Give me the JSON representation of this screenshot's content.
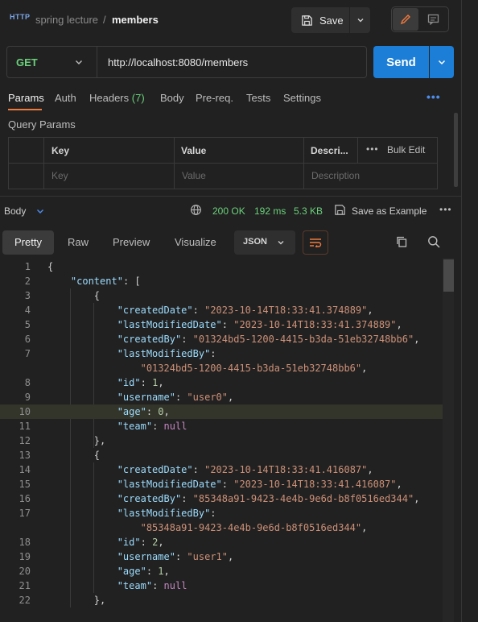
{
  "header": {
    "http_badge": "HTTP",
    "breadcrumb_parent": "spring lecture",
    "breadcrumb_separator": "/",
    "breadcrumb_current": "members",
    "save_label": "Save"
  },
  "request": {
    "method": "GET",
    "url": "http://localhost:8080/members",
    "send_label": "Send",
    "tabs": [
      "Params",
      "Auth",
      "Headers",
      "Body",
      "Pre-req.",
      "Tests",
      "Settings"
    ],
    "headers_count": "(7)",
    "active_tab": "Params",
    "query_params_title": "Query Params",
    "columns": {
      "key": "Key",
      "value": "Value",
      "description": "Descri..."
    },
    "placeholders": {
      "key": "Key",
      "value": "Value",
      "description": "Description"
    },
    "bulk_edit_label": "Bulk Edit"
  },
  "response": {
    "section_label": "Body",
    "status": "200 OK",
    "time": "192 ms",
    "size": "5.3 KB",
    "save_example_label": "Save as Example",
    "view_tabs": [
      "Pretty",
      "Raw",
      "Preview",
      "Visualize"
    ],
    "active_view": "Pretty",
    "format": "JSON"
  },
  "code_lines": [
    {
      "n": "1",
      "t": "{"
    },
    {
      "n": "2",
      "t": "    \"content\": ["
    },
    {
      "n": "3",
      "t": "        {"
    },
    {
      "n": "4",
      "t": "            \"createdDate\": \"2023-10-14T18:33:41.374889\","
    },
    {
      "n": "5",
      "t": "            \"lastModifiedDate\": \"2023-10-14T18:33:41.374889\","
    },
    {
      "n": "6",
      "t": "            \"createdBy\": \"01324bd5-1200-4415-b3da-51eb32748bb6\","
    },
    {
      "n": "7",
      "t": "            \"lastModifiedBy\":"
    },
    {
      "n": "",
      "t": "                \"01324bd5-1200-4415-b3da-51eb32748bb6\","
    },
    {
      "n": "8",
      "t": "            \"id\": 1,"
    },
    {
      "n": "9",
      "t": "            \"username\": \"user0\","
    },
    {
      "n": "10",
      "t": "            \"age\": 0,"
    },
    {
      "n": "11",
      "t": "            \"team\": null"
    },
    {
      "n": "12",
      "t": "        },"
    },
    {
      "n": "13",
      "t": "        {"
    },
    {
      "n": "14",
      "t": "            \"createdDate\": \"2023-10-14T18:33:41.416087\","
    },
    {
      "n": "15",
      "t": "            \"lastModifiedDate\": \"2023-10-14T18:33:41.416087\","
    },
    {
      "n": "16",
      "t": "            \"createdBy\": \"85348a91-9423-4e4b-9e6d-b8f0516ed344\","
    },
    {
      "n": "17",
      "t": "            \"lastModifiedBy\":"
    },
    {
      "n": "",
      "t": "                \"85348a91-9423-4e4b-9e6d-b8f0516ed344\","
    },
    {
      "n": "18",
      "t": "            \"id\": 2,"
    },
    {
      "n": "19",
      "t": "            \"username\": \"user1\","
    },
    {
      "n": "20",
      "t": "            \"age\": 1,"
    },
    {
      "n": "21",
      "t": "            \"team\": null"
    },
    {
      "n": "22",
      "t": "        },"
    }
  ],
  "highlighted_line": "10",
  "colors": {
    "background": "#212121",
    "accent_orange": "#f07a3e",
    "send_blue": "#1c7ed6",
    "status_green": "#6bd17b",
    "json_key": "#9cdcfe",
    "json_string": "#ce9178",
    "json_number": "#b5cea8"
  },
  "icons": [
    "http-icon",
    "save-icon",
    "chevron-down-icon",
    "pencil-icon",
    "comment-icon",
    "more-dots-icon",
    "globe-icon",
    "save-example-icon",
    "wrap-icon",
    "copy-icon",
    "search-icon"
  ]
}
